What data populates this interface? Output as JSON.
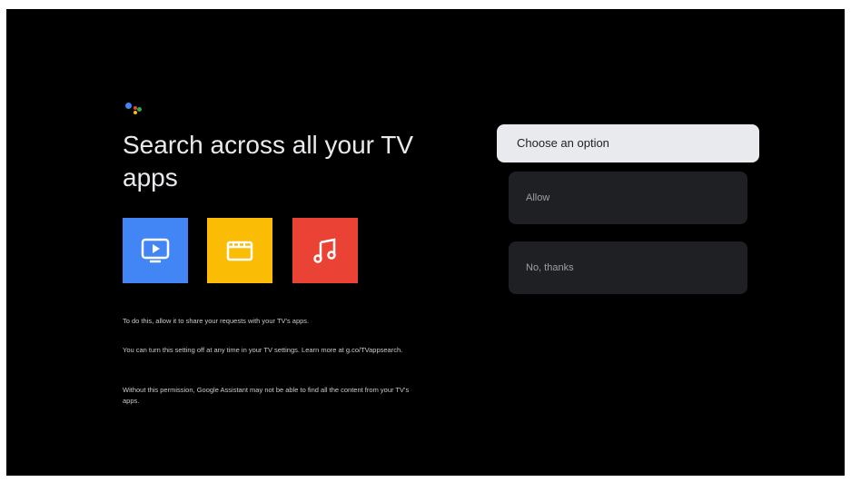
{
  "header": {
    "logo_icon": "google-assistant-dots-icon",
    "title": "Search across all your TV apps"
  },
  "tiles": [
    {
      "icon": "tv-play-icon",
      "color": "#4285F4"
    },
    {
      "icon": "film-clapper-icon",
      "color": "#FBBC05"
    },
    {
      "icon": "music-note-icon",
      "color": "#EA4335"
    }
  ],
  "body": {
    "p1": "To do this, allow it to share your requests with your TV's apps.",
    "p2": "You can turn this setting off at any time in your TV settings. Learn more at g.co/TVappsearch.",
    "p3": "Without this permission, Google Assistant may not be able to find all the content from your TV's apps."
  },
  "options": {
    "prompt": "Choose an option",
    "allow": "Allow",
    "decline": "No, thanks"
  },
  "colors": {
    "background": "#000000",
    "focused_option": "#e8eaed",
    "option": "#1f2023"
  }
}
